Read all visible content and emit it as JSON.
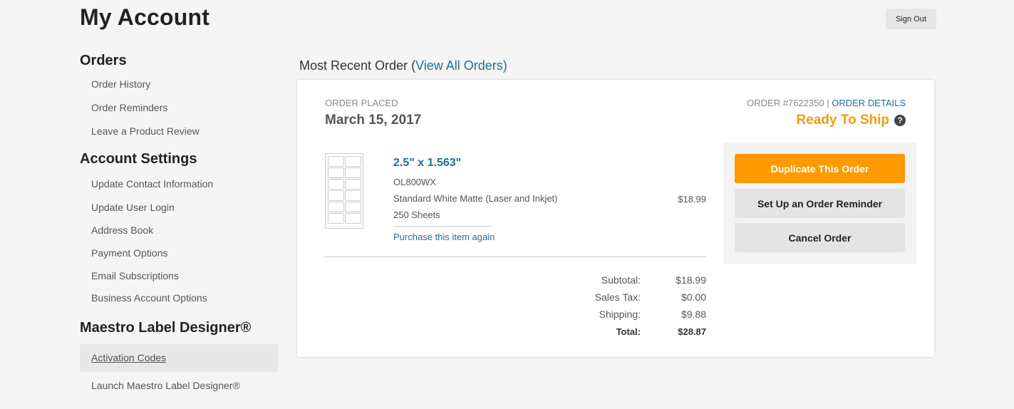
{
  "page": {
    "title": "My Account",
    "sign_out": "Sign Out"
  },
  "sidebar": {
    "orders": {
      "heading": "Orders",
      "items": [
        "Order History",
        "Order Reminders",
        "Leave a Product Review"
      ]
    },
    "account_settings": {
      "heading": "Account Settings",
      "items": [
        "Update Contact Information",
        "Update User Login",
        "Address Book",
        "Payment Options",
        "Email Subscriptions",
        "Business Account Options"
      ]
    },
    "maestro": {
      "heading": "Maestro Label Designer®",
      "items": [
        "Activation Codes",
        "Launch Maestro Label Designer®"
      ],
      "active_item": "Activation Codes"
    }
  },
  "recent": {
    "heading": "Most Recent Order",
    "view_all_open": "(",
    "view_all": "View All Orders",
    "view_all_close": ")"
  },
  "order": {
    "placed_label": "ORDER PLACED",
    "date": "March 15, 2017",
    "number": "ORDER #7622350",
    "separator": "|",
    "details_link": "ORDER DETAILS",
    "status": "Ready To Ship",
    "status_color": "#f29b12",
    "item": {
      "title": "2.5\" x 1.563\"",
      "sku": "OL800WX",
      "material": "Standard White Matte (Laser and Inkjet)",
      "quantity": "250 Sheets",
      "price": "$18.99",
      "purchase_again": "Purchase this item again"
    },
    "summary": [
      {
        "label": "Subtotal:",
        "value": "$18.99"
      },
      {
        "label": "Sales Tax:",
        "value": "$0.00"
      },
      {
        "label": "Shipping:",
        "value": "$9.88"
      },
      {
        "label": "Total:",
        "value": "$28.87"
      }
    ]
  },
  "actions": {
    "duplicate": "Duplicate This Order",
    "reminder": "Set Up an Order Reminder",
    "cancel": "Cancel Order",
    "primary_color": "#ff9900"
  },
  "icons": {
    "help": "question-circle-icon"
  }
}
